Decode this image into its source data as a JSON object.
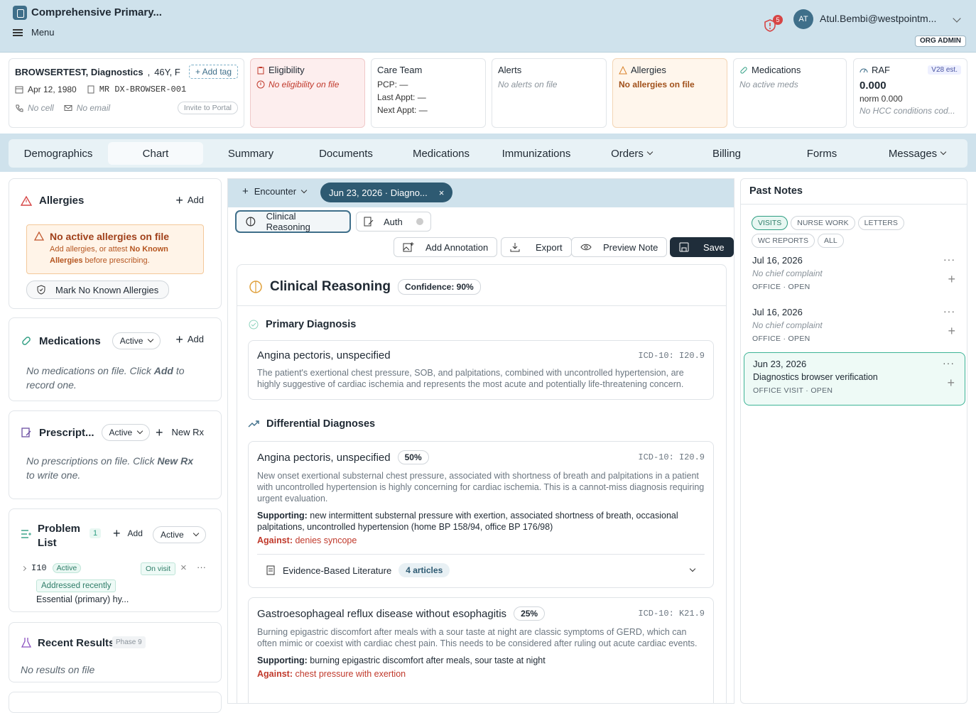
{
  "app": {
    "title": "Comprehensive Primary...",
    "menu_label": "Menu"
  },
  "user": {
    "initials": "AT",
    "email": "Atul.Bembi@westpointm...",
    "role": "ORG ADMIN",
    "notifications": "5"
  },
  "patient": {
    "name": "BROWSERTEST, Diagnostics",
    "age_sex": "46Y, F",
    "add_tag": "+ Add tag",
    "dob": "Apr 12, 1980",
    "mrn": "MR DX-BROWSER-001",
    "phone": "No cell",
    "email": "No email",
    "invite": "Invite to Portal"
  },
  "eligibility": {
    "title": "Eligibility",
    "value": "No eligibility on file"
  },
  "care_team": {
    "title": "Care Team",
    "pcp": "PCP: —",
    "last_appt": "Last Appt: —",
    "next_appt": "Next Appt: —"
  },
  "alerts": {
    "title": "Alerts",
    "value": "No alerts on file"
  },
  "allergies_card": {
    "title": "Allergies",
    "value": "No allergies on file"
  },
  "medications_card": {
    "title": "Medications",
    "value": "No active meds"
  },
  "raf": {
    "title": "RAF",
    "badge": "V28 est.",
    "value": "0.000",
    "norm": "norm 0.000",
    "note": "No HCC conditions cod..."
  },
  "nav": {
    "tabs": [
      {
        "label": "Demographics"
      },
      {
        "label": "Chart"
      },
      {
        "label": "Summary"
      },
      {
        "label": "Documents"
      },
      {
        "label": "Medications"
      },
      {
        "label": "Immunizations"
      },
      {
        "label": "Orders"
      },
      {
        "label": "Billing"
      },
      {
        "label": "Forms"
      },
      {
        "label": "Messages"
      }
    ]
  },
  "left": {
    "allergies": {
      "title": "Allergies",
      "add": "Add",
      "warn_title": "No active allergies on file",
      "warn_pre": "Add allergies, or attest ",
      "warn_bold": "No Known Allergies",
      "warn_post": " before prescribing.",
      "nka_button": "Mark No Known Allergies"
    },
    "medications": {
      "title": "Medications",
      "filter": "Active",
      "add": "Add",
      "empty_pre": "No medications on file. Click ",
      "empty_bold": "Add",
      "empty_post": " to record one."
    },
    "prescriptions": {
      "title": "Prescript...",
      "filter": "Active",
      "new": "New Rx",
      "empty_pre": "No prescriptions on file. Click ",
      "empty_bold": "New Rx",
      "empty_post": " to write one."
    },
    "problems": {
      "title": "Problem List",
      "count": "1",
      "add": "Add",
      "filter": "Active",
      "item": {
        "code": "I10",
        "status": "Active",
        "visit": "On visit",
        "tag": "Addressed recently",
        "desc": "Essential (primary) hy..."
      }
    },
    "results": {
      "title": "Recent Results",
      "phase": "Phase 9",
      "empty": "No results on file"
    }
  },
  "center": {
    "encounter_label": "Encounter",
    "encounter_chip": "Jun 23, 2026 · Diagno...",
    "subtabs": [
      "Clinical Reasoning",
      "Auth"
    ],
    "actions": {
      "annotation": "Add Annotation",
      "export": "Export",
      "preview": "Preview Note",
      "save": "Save"
    },
    "title": "Clinical Reasoning",
    "confidence": "Confidence: 90%",
    "primary_header": "Primary Diagnosis",
    "primary": {
      "name": "Angina pectoris, unspecified",
      "icd": "ICD-10: I20.9",
      "text": "The patient's exertional chest pressure, SOB, and palpitations, combined with uncontrolled hypertension, are highly suggestive of cardiac ischemia and represents the most acute and potentially life-threatening concern."
    },
    "diff_header": "Differential Diagnoses",
    "diffs": [
      {
        "name": "Angina pectoris, unspecified",
        "pct": "50%",
        "icd": "ICD-10: I20.9",
        "text": "New onset exertional substernal chest pressure, associated with shortness of breath and palpitations in a patient with uncontrolled hypertension is highly concerning for cardiac ischemia. This is a cannot-miss diagnosis requiring urgent evaluation.",
        "supporting_label": "Supporting:",
        "supporting": " new intermittent substernal pressure with exertion, associated shortness of breath, occasional palpitations, uncontrolled hypertension (home BP 158/94, office BP 176/98)",
        "against_label": "Against:",
        "against": " denies syncope",
        "lit_label": "Evidence-Based Literature",
        "lit_count": "4 articles"
      },
      {
        "name": "Gastroesophageal reflux disease without esophagitis",
        "pct": "25%",
        "icd": "ICD-10: K21.9",
        "text": "Burning epigastric discomfort after meals with a sour taste at night are classic symptoms of GERD, which can often mimic or coexist with cardiac chest pain. This needs to be considered after ruling out acute cardiac events.",
        "supporting_label": "Supporting:",
        "supporting": " burning epigastric discomfort after meals, sour taste at night",
        "against_label": "Against:",
        "against": " chest pressure with exertion"
      }
    ]
  },
  "right": {
    "title": "Past Notes",
    "filters": [
      "VISITS",
      "NURSE WORK",
      "LETTERS",
      "WC REPORTS",
      "ALL"
    ],
    "notes": [
      {
        "date": "Jul 16, 2026",
        "sub": "No chief complaint",
        "type": "OFFICE",
        "status": "OPEN"
      },
      {
        "date": "Jul 16, 2026",
        "sub": "No chief complaint",
        "type": "OFFICE",
        "status": "OPEN"
      },
      {
        "date": "Jun 23, 2026",
        "sub": "Diagnostics browser verification",
        "type": "OFFICE VISIT",
        "status": "OPEN"
      }
    ]
  },
  "colors": {
    "accent": "#3f6f8a",
    "header_bg": "#cfe2ec",
    "teal": "#2e9e82",
    "danger": "#c0392b",
    "warn_bg": "#fff4e8",
    "save_bg": "#1f2d3a"
  }
}
